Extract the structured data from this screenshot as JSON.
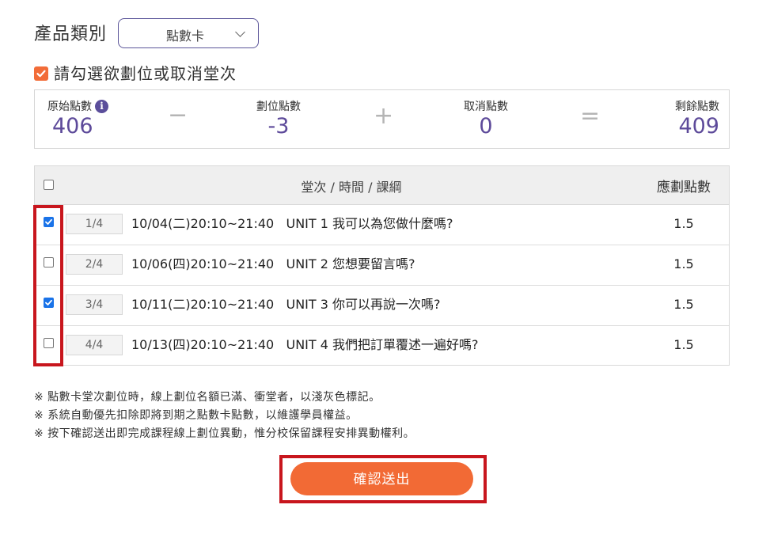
{
  "product": {
    "label": "產品類別",
    "selected": "點數卡"
  },
  "hint": {
    "text": "請勾選欲劃位或取消堂次",
    "checked": true
  },
  "summary": {
    "original_label": "原始點數",
    "original_value": "406",
    "minus": "−",
    "booked_label": "劃位點數",
    "booked_value": "-3",
    "plus": "+",
    "cancel_label": "取消點數",
    "cancel_value": "0",
    "equals": "=",
    "remaining_label": "剩餘點數",
    "remaining_value": "409",
    "info_icon": "i"
  },
  "table": {
    "header_lesson": "堂次 / 時間 / 課綱",
    "header_points": "應劃點數",
    "rows": [
      {
        "badge": "1/4",
        "lesson": "10/04(二)20:10~21:40   UNIT 1 我可以為您做什麼嗎?",
        "points": "1.5",
        "checked": true
      },
      {
        "badge": "2/4",
        "lesson": "10/06(四)20:10~21:40   UNIT 2 您想要留言嗎?",
        "points": "1.5",
        "checked": false
      },
      {
        "badge": "3/4",
        "lesson": "10/11(二)20:10~21:40   UNIT 3 你可以再說一次嗎?",
        "points": "1.5",
        "checked": true
      },
      {
        "badge": "4/4",
        "lesson": "10/13(四)20:10~21:40   UNIT 4 我們把訂單覆述一遍好嗎?",
        "points": "1.5",
        "checked": false
      }
    ]
  },
  "notes": [
    "※ 點數卡堂次劃位時，線上劃位名額已滿、衝堂者，以淺灰色標記。",
    "※ 系統自動優先扣除即將到期之點數卡點數，以維護學員權益。",
    "※ 按下確認送出即完成課程線上劃位異動，惟分校保留課程安排異動權利。"
  ],
  "submit_label": "確認送出",
  "colors": {
    "accent": "#f26a35",
    "purple": "#5d4a9a",
    "highlight": "#c8161d",
    "checkbox": "#1a73e8"
  }
}
